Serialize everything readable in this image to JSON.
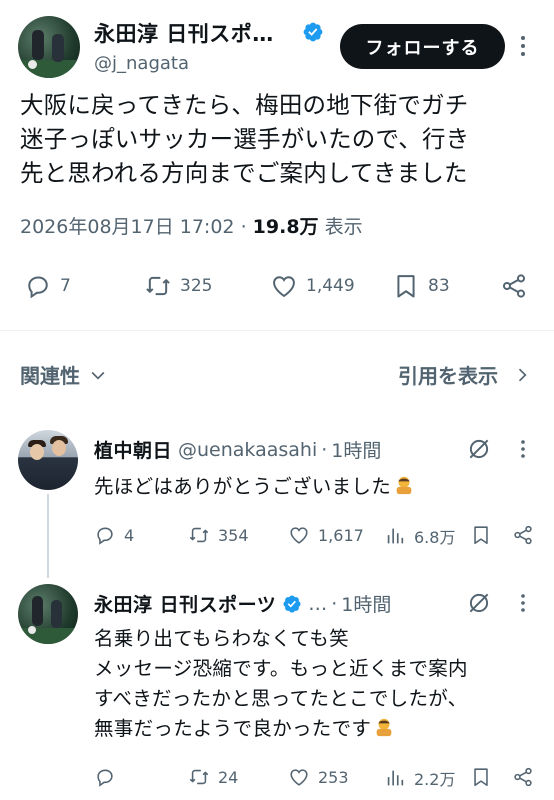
{
  "main_tweet": {
    "author_name": "永田淳 日刊スポ…",
    "handle": "@j_nagata",
    "follow_label": "フォローする",
    "text_lines": [
      "大阪に戻ってきたら、梅田の地下街でガチ",
      "迷子っぽいサッカー選手がいたので、行き",
      "先と思われる方向までご案内してきました"
    ],
    "datetime": "2026年08月17日 17:02",
    "separator": "·",
    "views_count": "19.8万",
    "views_label": "表示",
    "actions": {
      "replies": "7",
      "retweets": "325",
      "likes": "1,449",
      "bookmarks": "83"
    }
  },
  "sort_bar": {
    "related_label": "関連性",
    "quotes_label": "引用を表示"
  },
  "replies": [
    {
      "author_name": "植中朝日",
      "handle": "@uenakaasahi",
      "separator": "·",
      "time": "1時間",
      "text_lines": [
        "先ほどはありがとうございました"
      ],
      "actions": {
        "replies": "4",
        "retweets": "354",
        "likes": "1,617",
        "views": "6.8万"
      }
    },
    {
      "author_name": "永田淳 日刊スポーツ",
      "handle": "…",
      "separator": "·",
      "time": "1時間",
      "text_lines": [
        "名乗り出てもらわなくても笑",
        "メッセージ恐縮です。もっと近くまで案内",
        "すべきだったかと思ってたとこでしたが、",
        "無事だったようで良かったです"
      ],
      "actions": {
        "replies": "",
        "retweets": "24",
        "likes": "253",
        "views": "2.2万"
      }
    }
  ],
  "colors": {
    "text_primary": "#0f1419",
    "text_secondary": "#536471",
    "verified_blue": "#1d9bf0",
    "follow_button_bg": "#0f1419",
    "divider": "#eff3f4"
  }
}
